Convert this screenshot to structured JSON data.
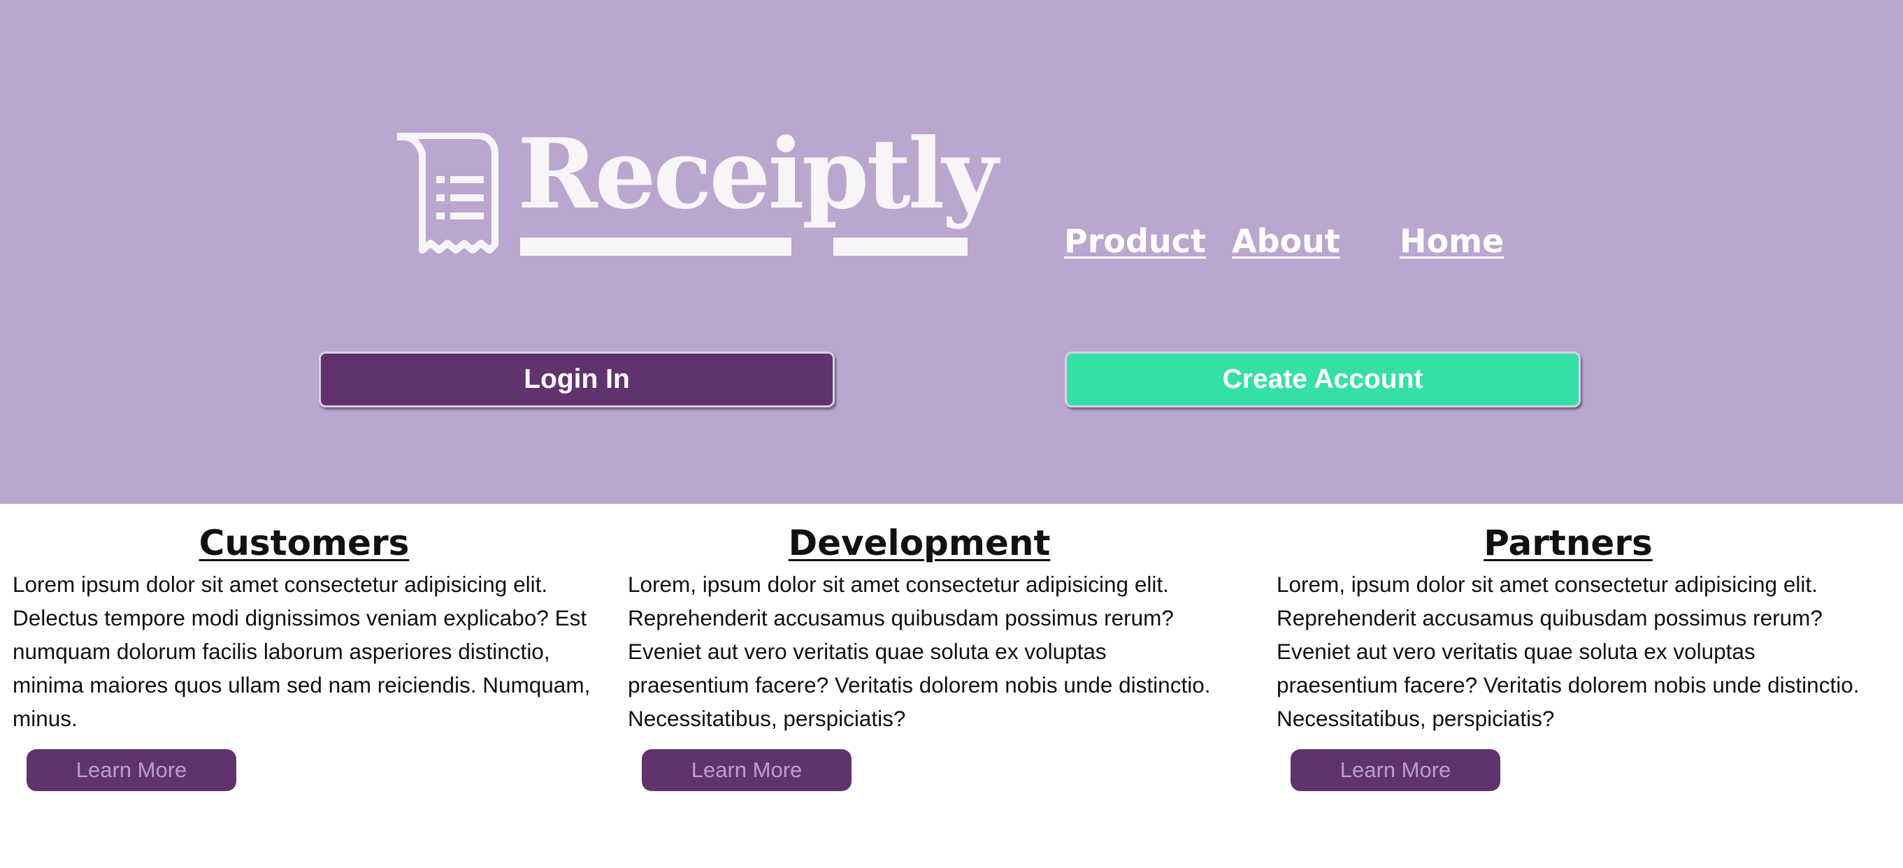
{
  "brand": {
    "name": "Receiptly",
    "colors": {
      "hero_bg": "#baa6cf",
      "primary_purple": "#60336e",
      "accent_green": "#35e0a8",
      "logo_white": "#f7f5f8"
    },
    "icon": "receipt-icon"
  },
  "nav": {
    "product": "Product",
    "about": "About",
    "home": "Home"
  },
  "hero": {
    "login_label": "Login In",
    "create_label": "Create Account"
  },
  "columns": [
    {
      "title": "Customers",
      "text": "Lorem ipsum dolor sit amet consectetur adipisicing elit. Delectus tempore modi dignissimos veniam explicabo? Est numquam dolorum facilis laborum asperiores distinctio, minima maiores quos ullam sed nam reiciendis. Numquam, minus.",
      "button": "Learn More"
    },
    {
      "title": "Development",
      "text": "Lorem, ipsum dolor sit amet consectetur adipisicing elit. Reprehenderit accusamus quibusdam possimus rerum? Eveniet aut vero veritatis quae soluta ex voluptas praesentium facere? Veritatis dolorem nobis unde distinctio. Necessitatibus, perspiciatis?",
      "button": "Learn More"
    },
    {
      "title": "Partners",
      "text": "Lorem, ipsum dolor sit amet consectetur adipisicing elit. Reprehenderit accusamus quibusdam possimus rerum? Eveniet aut vero veritatis quae soluta ex voluptas praesentium facere? Veritatis dolorem nobis unde distinctio. Necessitatibus, perspiciatis?",
      "button": "Learn More"
    }
  ]
}
